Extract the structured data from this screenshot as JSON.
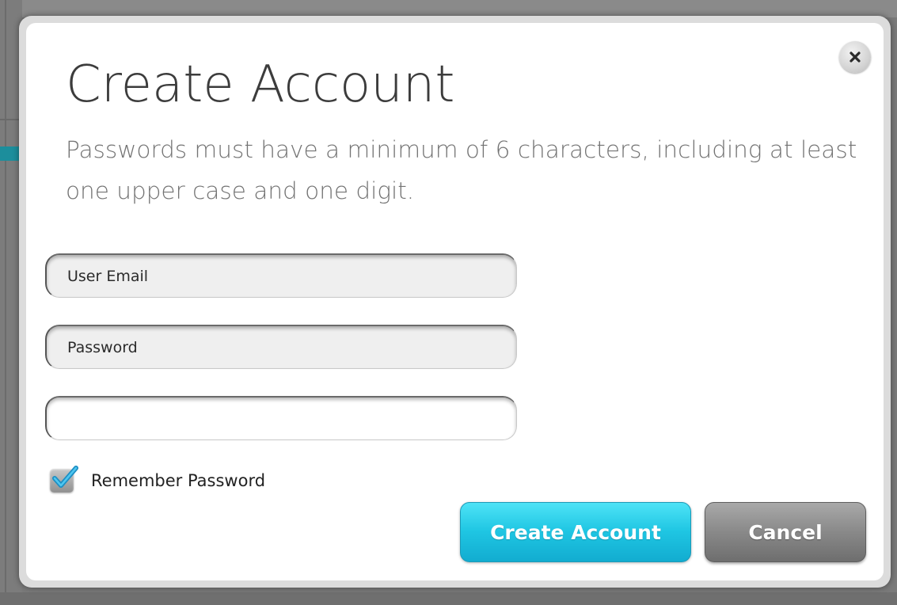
{
  "dialog": {
    "title": "Create Account",
    "subtitle": "Passwords must have a minimum of 6 characters, including at least one upper case and one digit.",
    "close_icon": "close-icon"
  },
  "form": {
    "email": {
      "placeholder": "User Email",
      "value": ""
    },
    "password": {
      "placeholder": "Password",
      "value": ""
    },
    "confirm_password": {
      "placeholder": "",
      "value": ""
    },
    "remember": {
      "label": "Remember Password",
      "checked": true,
      "icon": "checkmark-icon"
    }
  },
  "actions": {
    "create_label": "Create Account",
    "cancel_label": "Cancel"
  },
  "colors": {
    "accent": "#1fc6e3",
    "cancel": "#8a8a8a",
    "backdrop_accent": "#1c8e9c"
  }
}
